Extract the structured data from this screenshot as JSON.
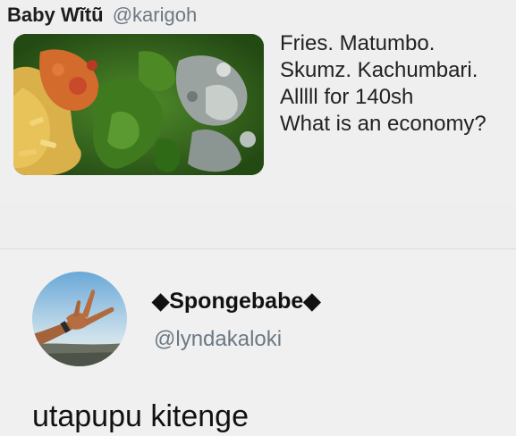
{
  "quoted_tweet": {
    "display_name": "Baby Wĩtũ",
    "handle": "@karigoh",
    "photo_icon": "food-plate-photo",
    "text_lines": [
      "Fries. Matumbo.",
      "Skumz. Kachumbari.",
      "Alllll for 140sh",
      "What is an economy?"
    ]
  },
  "tweet": {
    "display_name": "◆Spongebabe◆",
    "handle": "@lyndakaloki",
    "avatar_icon": "hand-sign-avatar",
    "text": "utapupu kitenge"
  },
  "colors": {
    "background": "#eeeeee",
    "handle_gray": "#6b7885",
    "text": "#111111"
  }
}
